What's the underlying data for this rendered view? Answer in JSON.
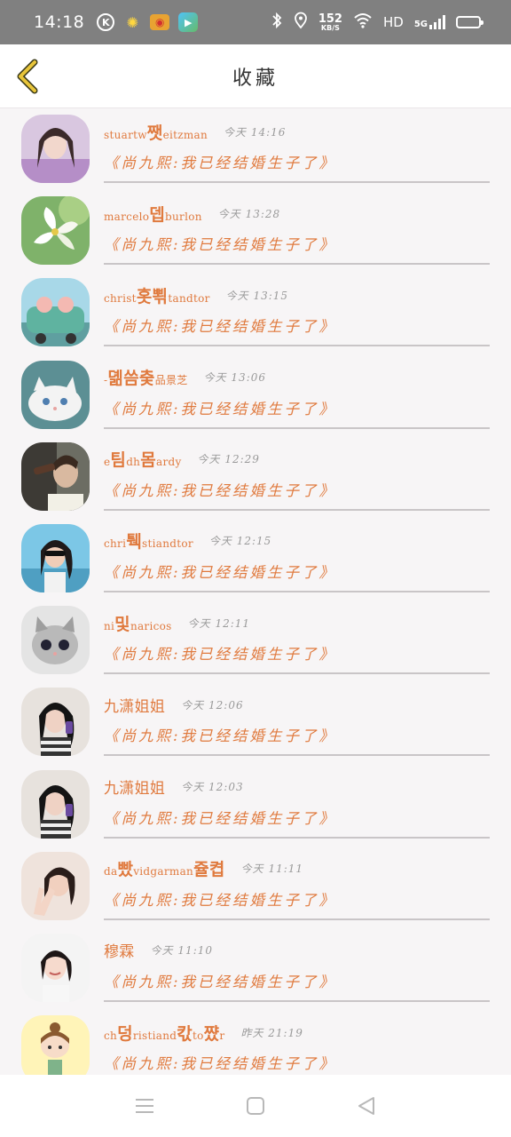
{
  "status_bar": {
    "time": "14:18",
    "speed_value": "152",
    "speed_unit": "KB/S",
    "hd": "HD",
    "net": "5G"
  },
  "header": {
    "title": "收藏"
  },
  "colors": {
    "accent": "#e07a3e",
    "back_arrow": "#e8c53a",
    "divider": "#c9c5c7",
    "timestamp": "#9a9a9a"
  },
  "favorites": [
    {
      "sender_pre": "stuartw",
      "sender_big": "쨋",
      "sender_post": "eitzman",
      "time": "今天 14:16",
      "quote": "《尚九熙:我已经结婚生子了》",
      "avatar": "girl-portrait"
    },
    {
      "sender_pre": "marcelo",
      "sender_big": "뎁",
      "sender_post": "burlon",
      "time": "今天 13:28",
      "quote": "《尚九熙:我已经结婚生子了》",
      "avatar": "white-flower"
    },
    {
      "sender_pre": "christ",
      "sender_big": "홋뾖",
      "sender_post": "tandtor",
      "time": "今天 13:15",
      "quote": "《尚九熙:我已经结婚生子了》",
      "avatar": "pigs-in-car"
    },
    {
      "sender_pre": "-",
      "sender_big": "뎲씀츷",
      "sender_post": "品景芝",
      "time": "今天 13:06",
      "quote": "《尚九熙:我已经结婚生子了》",
      "avatar": "white-kitten"
    },
    {
      "sender_pre": "e",
      "sender_big": "팀",
      "sender_post": "dh",
      "sender_big2": "몸",
      "sender_post2": "ardy",
      "time": "今天 12:29",
      "quote": "《尚九熙:我已经结婚生子了》",
      "avatar": "man-drinking"
    },
    {
      "sender_pre": "chri",
      "sender_big": "퉥",
      "sender_post": "stiandtor",
      "time": "今天 12:15",
      "quote": "《尚九熙:我已经结婚生子了》",
      "avatar": "woman-sunglasses"
    },
    {
      "sender_pre": "ni",
      "sender_big": "및",
      "sender_post": "naricos",
      "time": "今天 12:11",
      "quote": "《尚九熙:我已经结婚生子了》",
      "avatar": "gray-cat"
    },
    {
      "sender_pre": "",
      "sender_big": "",
      "sender_post": "九潇姐姐",
      "time": "今天 12:06",
      "quote": "《尚九熙:我已经结婚生子了》",
      "avatar": "girl-black-hair"
    },
    {
      "sender_pre": "",
      "sender_big": "",
      "sender_post": "九潇姐姐",
      "time": "今天 12:03",
      "quote": "《尚九熙:我已经结婚生子了》",
      "avatar": "girl-black-hair"
    },
    {
      "sender_pre": "da",
      "sender_big": "빴",
      "sender_post": "vidgarman",
      "sender_big2": "쥴켭",
      "sender_post2": "",
      "time": "今天 11:11",
      "quote": "《尚九熙:我已经结婚生子了》",
      "avatar": "woman-peace"
    },
    {
      "sender_pre": "",
      "sender_big": "",
      "sender_post": "穆霖",
      "time": "今天 11:10",
      "quote": "《尚九熙:我已经结婚生子了》",
      "avatar": "woman-smile"
    },
    {
      "sender_pre": "ch",
      "sender_big": "덩",
      "sender_post": "ristiand",
      "sender_big2": "칷",
      "sender_post2": "to",
      "sender_big3": "쨨",
      "sender_post3": "r",
      "time": "昨天 21:19",
      "quote": "《尚九熙:我已经结婚生子了》",
      "avatar": "cartoon-girl"
    }
  ]
}
